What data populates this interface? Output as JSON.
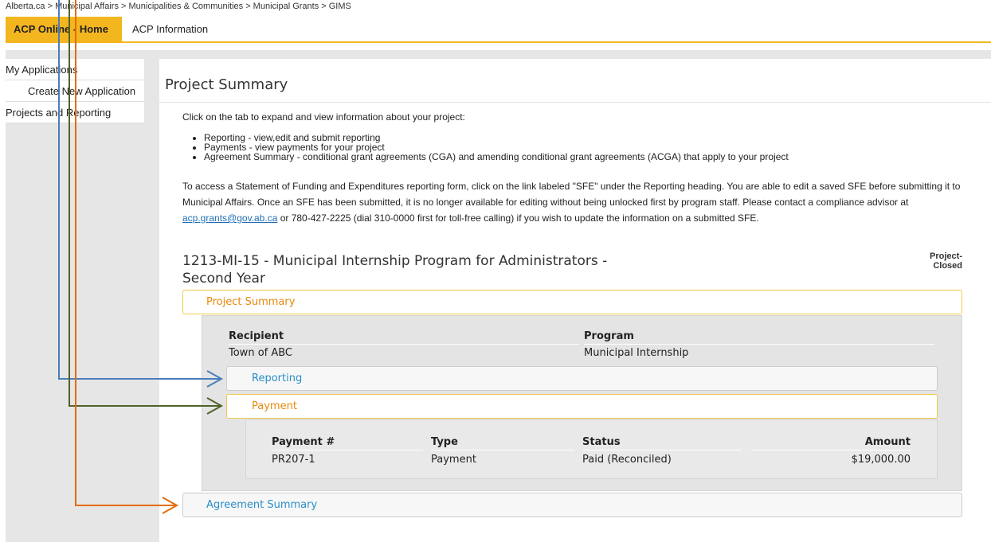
{
  "breadcrumb": "Alberta.ca > Municipal Affairs > Municipalities & Communities > Municipal Grants > GIMS",
  "topnav": {
    "home": "ACP Online - Home",
    "info": "ACP Information"
  },
  "sidebar": {
    "items": [
      {
        "label": "My Applications"
      },
      {
        "label": "Create New Application"
      },
      {
        "label": "Projects and Reporting"
      }
    ]
  },
  "main": {
    "title": "Project Summary",
    "intro": "Click on the tab to expand and view information about your project:",
    "bullets": [
      "Reporting - view,edit and submit reporting",
      "Payments - view payments for your project",
      "Agreement Summary - conditional grant agreements (CGA) and amending conditional grant agreements (ACGA) that apply to your project"
    ],
    "access_before": "To access a Statement of Funding and Expenditures reporting form, click on the link labeled \"SFE\" under the Reporting heading. You are able to edit a saved SFE before submitting it to Municipal Affairs. Once an SFE has been submitted, it is no longer available for editing without being unlocked first by program staff. Please contact a compliance advisor at ",
    "email": "acp.grants@gov.ab.ca",
    "access_after": " or 780-427-2225 (dial 310-0000 first for toll-free calling) if you wish to update the information on a submitted SFE."
  },
  "project": {
    "title": "1213-MI-15 - Municipal Internship Program for Administrators - Second Year",
    "status_line1": "Project-",
    "status_line2": "Closed"
  },
  "panels": {
    "summary": "Project Summary",
    "reporting": "Reporting",
    "payment": "Payment",
    "agreement": "Agreement Summary"
  },
  "summary_fields": {
    "recipient_label": "Recipient",
    "recipient_value": "Town of ABC",
    "program_label": "Program",
    "program_value": "Municipal Internship"
  },
  "payments": {
    "headers": [
      "Payment #",
      "Type",
      "Status",
      "Amount"
    ],
    "rows": [
      [
        "PR207-1",
        "Payment",
        "Paid (Reconciled)",
        "$19,000.00"
      ]
    ]
  },
  "colors": {
    "accent": "#f3b61f",
    "open_panel_text": "#e8890c",
    "closed_panel_text": "#2a8ec7",
    "arrow_blue": "#4a7ebb",
    "arrow_green": "#4f6228",
    "arrow_orange": "#e46c0a"
  }
}
